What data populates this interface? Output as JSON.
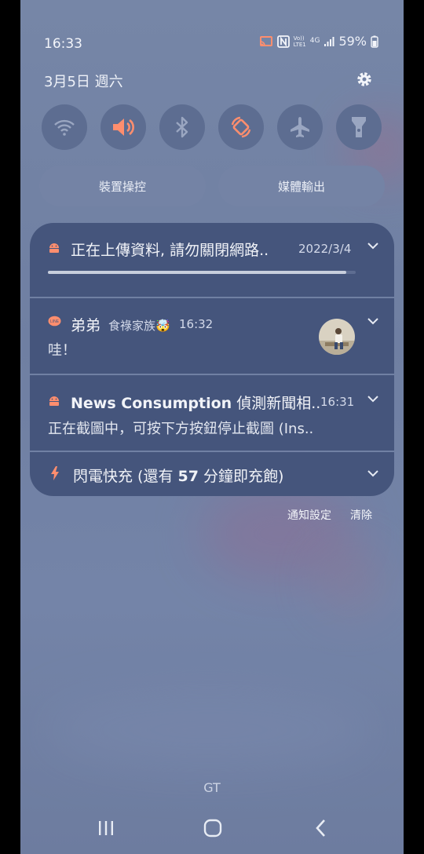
{
  "status_bar": {
    "time": "16:33",
    "volte": "Vo))",
    "lte": "LTE1",
    "network": "4G",
    "battery": "59%"
  },
  "header": {
    "date": "3月5日 週六"
  },
  "quick_settings": {
    "toggles": [
      "wifi-icon",
      "sound-icon",
      "bluetooth-icon",
      "auto-rotate-icon",
      "airplane-icon",
      "flashlight-icon"
    ],
    "device_control_label": "裝置操控",
    "media_output_label": "媒體輸出"
  },
  "notifications": [
    {
      "app_icon": "android-icon",
      "title": "正在上傳資料, 請勿關閉網路..",
      "time": "2022/3/4",
      "progress": 0.97
    },
    {
      "app_icon": "line-icon",
      "sender": "弟弟",
      "group": "食祿家族🤯",
      "time": "16:32",
      "message": "哇！"
    },
    {
      "app_icon": "android-icon",
      "title": "News Consumption",
      "title_rest": "偵測新聞相..",
      "time": "16:31",
      "message": "正在截圖中，可按下方按鈕停止截圖 (Ins.."
    },
    {
      "app_icon": "bolt-icon",
      "prefix": "閃電快充 (還有",
      "minutes": "57",
      "suffix": "分鐘即充飽)"
    }
  ],
  "actions": {
    "settings_label": "通知設定",
    "clear_label": "清除"
  },
  "background_label": "GT",
  "colors": {
    "panel": "#45557c",
    "accent": "#ff8e6e",
    "line_green": "#ff5a5a",
    "progress": "#c8cfdd"
  }
}
